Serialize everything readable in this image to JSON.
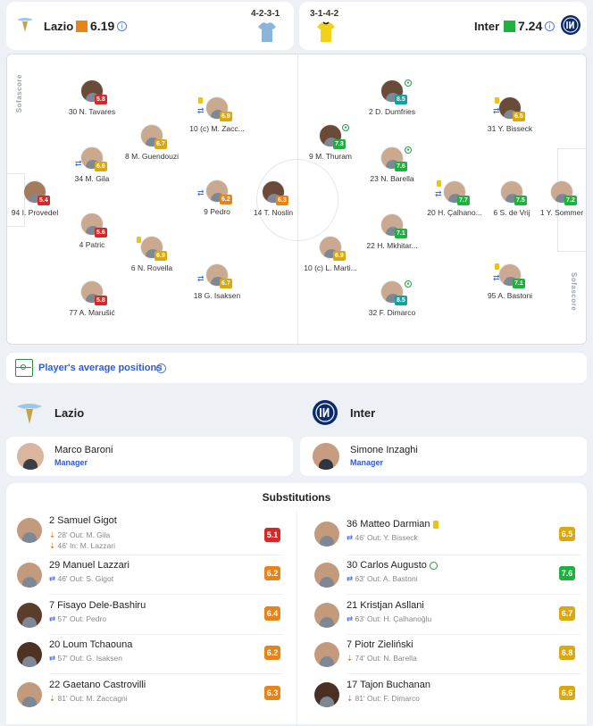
{
  "header": {
    "home": {
      "name": "Lazio",
      "rating": "6.19",
      "formation": "4-2-3-1",
      "rating_color": "#e8831a",
      "kit_color": "#8ab6dd"
    },
    "away": {
      "name": "Inter",
      "rating": "7.24",
      "formation": "3-1-4-2",
      "rating_color": "#20b040",
      "kit_color": "#f2d218"
    }
  },
  "pitch": {
    "watermark": "Sofascore",
    "home_players": [
      {
        "name": "I. Provedel",
        "number": "94",
        "rating": "5.4",
        "color": "red"
      },
      {
        "name": "N. Tavares",
        "number": "30",
        "rating": "5.8",
        "color": "red"
      },
      {
        "name": "M. Gila",
        "number": "34",
        "rating": "6.6",
        "color": "yel"
      },
      {
        "name": "Patric",
        "number": "4",
        "rating": "5.6",
        "color": "red"
      },
      {
        "name": "A. Marušić",
        "number": "77",
        "rating": "5.8",
        "color": "red"
      },
      {
        "name": "M. Guendouzi",
        "number": "8",
        "rating": "6.7",
        "color": "yel"
      },
      {
        "name": "N. Rovella",
        "number": "6",
        "rating": "6.9",
        "color": "yel"
      },
      {
        "name": "(c) M. Zacc...",
        "number": "10",
        "rating": "6.9",
        "color": "yel"
      },
      {
        "name": "Pedro",
        "number": "9",
        "rating": "6.2",
        "color": "org"
      },
      {
        "name": "G. Isaksen",
        "number": "18",
        "rating": "6.7",
        "color": "yel"
      },
      {
        "name": "T. Noslin",
        "number": "14",
        "rating": "6.3",
        "color": "org"
      }
    ],
    "away_players": [
      {
        "name": "D. Dumfries",
        "number": "2",
        "rating": "8.5",
        "color": "teal"
      },
      {
        "name": "M. Thuram",
        "number": "9",
        "rating": "7.3",
        "color": "grn"
      },
      {
        "name": "N. Barella",
        "number": "23",
        "rating": "7.6",
        "color": "grn"
      },
      {
        "name": "H. Mkhitar...",
        "number": "22",
        "rating": "7.1",
        "color": "grn"
      },
      {
        "name": "(c) L. Marti...",
        "number": "10",
        "rating": "6.9",
        "color": "yel"
      },
      {
        "name": "F. Dimarco",
        "number": "32",
        "rating": "8.5",
        "color": "teal"
      },
      {
        "name": "Y. Bisseck",
        "number": "31",
        "rating": "6.5",
        "color": "yel"
      },
      {
        "name": "H. Çalhano...",
        "number": "20",
        "rating": "7.7",
        "color": "grn"
      },
      {
        "name": "S. de Vrij",
        "number": "6",
        "rating": "7.5",
        "color": "grn"
      },
      {
        "name": "A. Bastoni",
        "number": "95",
        "rating": "7.1",
        "color": "grn"
      },
      {
        "name": "Y. Sommer",
        "number": "1",
        "rating": "7.2",
        "color": "grn"
      }
    ]
  },
  "avg_positions": {
    "label": "Player's average positions"
  },
  "teams": {
    "home": "Lazio",
    "away": "Inter"
  },
  "managers": {
    "home": {
      "name": "Marco Baroni",
      "role": "Manager"
    },
    "away": {
      "name": "Simone Inzaghi",
      "role": "Manager"
    }
  },
  "substitutions": {
    "title": "Substitutions",
    "home": [
      {
        "name": "2 Samuel Gigot",
        "line1": "28' Out: M. Gila",
        "line2": "46' In: M. Lazzari",
        "rating": "5.1",
        "color": "#d62828"
      },
      {
        "name": "29 Manuel Lazzari",
        "line1": "46' Out: S. Gigot",
        "rating": "6.2",
        "color": "#e8831a"
      },
      {
        "name": "7 Fisayo Dele-Bashiru",
        "line1": "57' Out: Pedro",
        "rating": "6.4",
        "color": "#e8831a"
      },
      {
        "name": "20 Loum Tchaouna",
        "line1": "57' Out: G. Isaksen",
        "rating": "6.2",
        "color": "#e8831a"
      },
      {
        "name": "22 Gaetano Castrovilli",
        "line1": "81' Out: M. Zaccagni",
        "rating": "6.3",
        "color": "#e8831a"
      }
    ],
    "away": [
      {
        "name": "36 Matteo Darmian",
        "line1": "46' Out: Y. Bisseck",
        "rating": "6.5",
        "color": "#d9a90f"
      },
      {
        "name": "30 Carlos Augusto",
        "line1": "63' Out: A. Bastoni",
        "rating": "7.6",
        "color": "#20b040"
      },
      {
        "name": "21 Kristjan Asllani",
        "line1": "63' Out: H. Çalhanoğlu",
        "rating": "6.7",
        "color": "#d9a90f"
      },
      {
        "name": "7 Piotr Zieliński",
        "line1": "74' Out: N. Barella",
        "rating": "6.8",
        "color": "#d9a90f"
      },
      {
        "name": "17 Tajon Buchanan",
        "line1": "81' Out: F. Dimarco",
        "rating": "6.6",
        "color": "#d9a90f"
      }
    ]
  }
}
